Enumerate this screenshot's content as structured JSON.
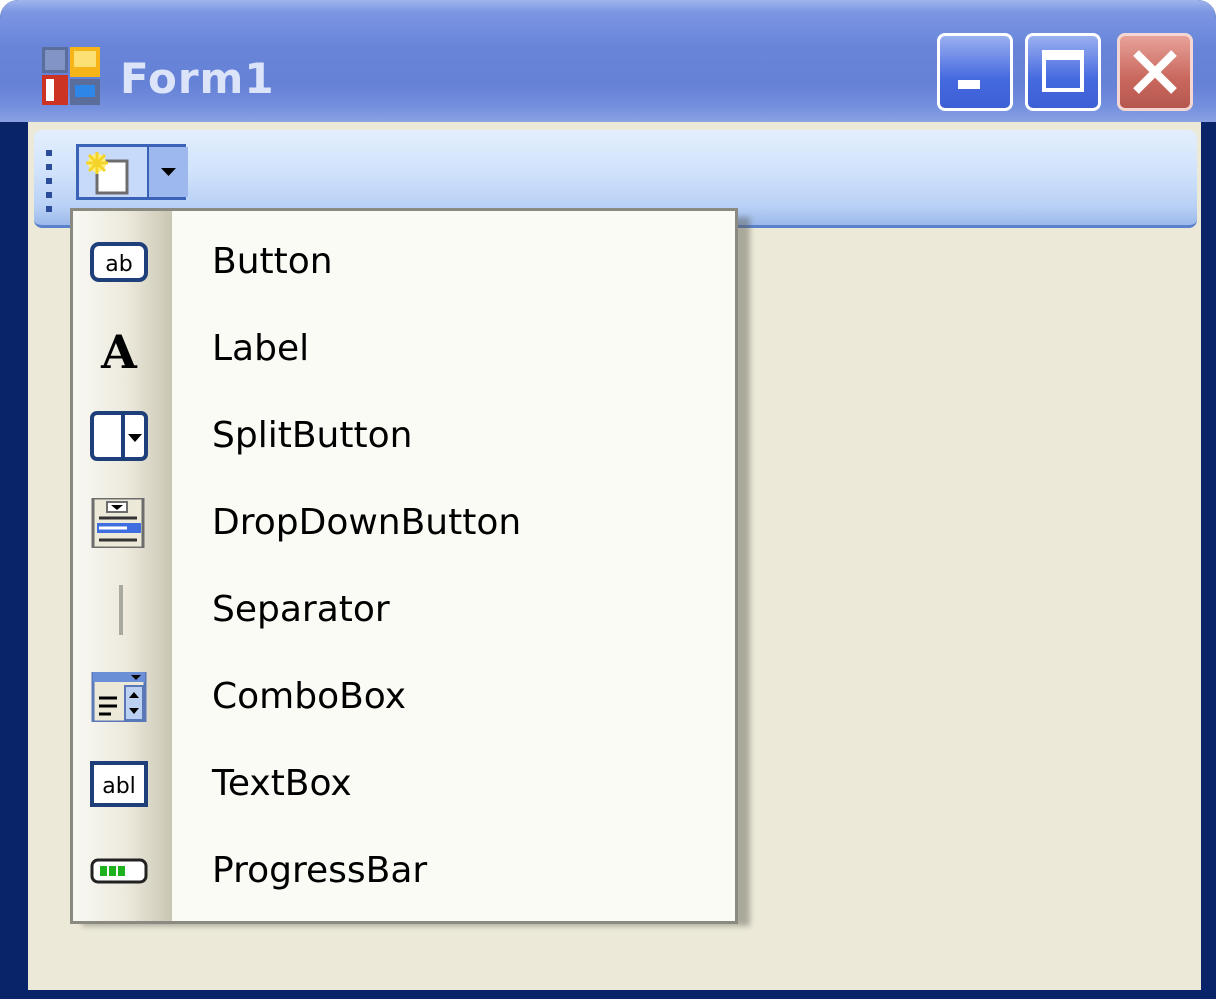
{
  "window": {
    "title": "Form1"
  },
  "toolstrip": {
    "new_item_button": "add-item-dropdown"
  },
  "menu": {
    "items": [
      {
        "label": "Button",
        "icon": "button-icon"
      },
      {
        "label": "Label",
        "icon": "label-icon"
      },
      {
        "label": "SplitButton",
        "icon": "split-button-icon"
      },
      {
        "label": "DropDownButton",
        "icon": "dropdown-button-icon"
      },
      {
        "label": "Separator",
        "icon": "separator-icon"
      },
      {
        "label": "ComboBox",
        "icon": "combobox-icon"
      },
      {
        "label": "TextBox",
        "icon": "textbox-icon"
      },
      {
        "label": "ProgressBar",
        "icon": "progressbar-icon"
      }
    ]
  },
  "icon_glyphs": {
    "button": "ab",
    "label": "A",
    "textbox": "abl"
  },
  "colors": {
    "titlebar": "#6682d7",
    "client": "#ece9d8",
    "menu_bg": "#fbfbf6",
    "close_button": "#c9675c"
  }
}
